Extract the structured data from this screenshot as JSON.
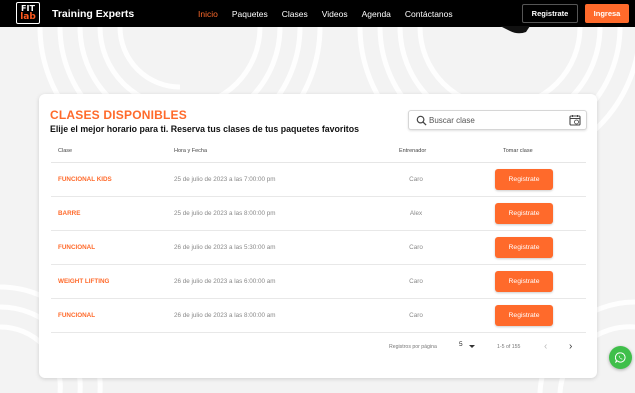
{
  "nav": {
    "logo_top": "FIT",
    "logo_bottom": "lab",
    "brand": "Training Experts",
    "menu": [
      {
        "label": "Inicio",
        "active": true
      },
      {
        "label": "Paquetes",
        "active": false
      },
      {
        "label": "Clases",
        "active": false
      },
      {
        "label": "Videos",
        "active": false
      },
      {
        "label": "Agenda",
        "active": false
      },
      {
        "label": "Contáctanos",
        "active": false
      }
    ],
    "register_label": "Registrate",
    "login_label": "Ingresa"
  },
  "card": {
    "title": "CLASES DISPONIBLES",
    "subtitle": "Elije el mejor horario para ti. Reserva tus clases de tus paquetes favoritos",
    "search_placeholder": "Buscar clase",
    "columns": {
      "clase": "Clase",
      "hora": "Hora y Fecha",
      "entrenador": "Entrenador",
      "tomar": "Tomar clase"
    },
    "rows": [
      {
        "clase": "FUNCIONAL KIDS",
        "fecha": "25 de julio de 2023 a las 7:00:00 pm",
        "entrenador": "Caro",
        "accion": "Registrate"
      },
      {
        "clase": "BARRE",
        "fecha": "25 de julio de 2023 a las 8:00:00 pm",
        "entrenador": "Alex",
        "accion": "Registrate"
      },
      {
        "clase": "FUNCIONAL",
        "fecha": "26 de julio de 2023 a las 5:30:00 am",
        "entrenador": "Caro",
        "accion": "Registrate"
      },
      {
        "clase": "WEIGHT LIFTING",
        "fecha": "26 de julio de 2023 a las 6:00:00 am",
        "entrenador": "Caro",
        "accion": "Registrate"
      },
      {
        "clase": "FUNCIONAL",
        "fecha": "26 de julio de 2023 a las 8:00:00 am",
        "entrenador": "Caro",
        "accion": "Registrate"
      }
    ],
    "pagination": {
      "rows_label": "Registros por página",
      "rows_value": "5",
      "range": "1-5 of 155",
      "prev": "‹",
      "next": "›"
    }
  },
  "colors": {
    "accent": "#ff6a2b",
    "nav_bg": "#000000",
    "whatsapp": "#3fbf4a"
  },
  "icons": [
    "search-icon",
    "calendar-icon",
    "whatsapp-icon",
    "chevron-left-icon",
    "chevron-right-icon"
  ]
}
